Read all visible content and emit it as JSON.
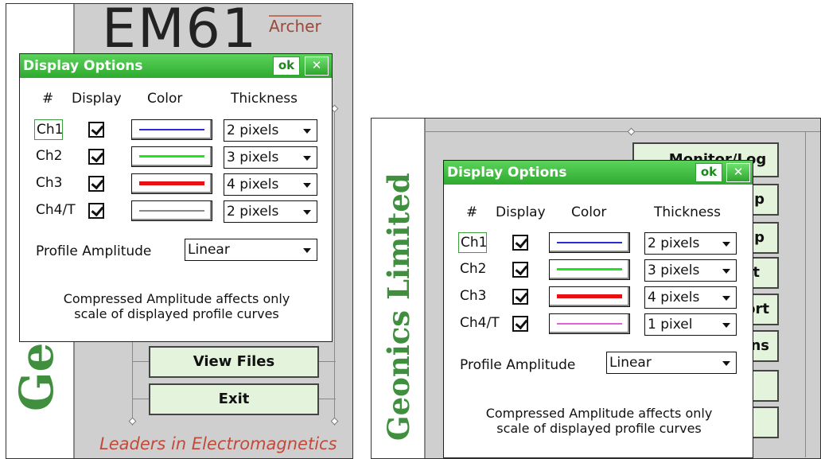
{
  "panel_left": {
    "app_title": "EM61",
    "variant": "Archer",
    "brand_vertical": "Ge",
    "tagline": "Leaders in Electromagnetics",
    "menu": [
      {
        "label": "View Files",
        "mnemonic": "V"
      },
      {
        "label": "Exit",
        "mnemonic": "x"
      }
    ],
    "dialog": {
      "title": "Display Options",
      "ok_label": "ok",
      "close_label": "✕",
      "headers": {
        "num": "#",
        "display": "Display",
        "color": "Color",
        "thickness": "Thickness"
      },
      "channels": [
        {
          "label": "Ch1",
          "checked": true,
          "color": "#2a2ad6",
          "thickness": "2 pixels"
        },
        {
          "label": "Ch2",
          "checked": true,
          "color": "#1fe61f",
          "thickness": "3 pixels"
        },
        {
          "label": "Ch3",
          "checked": true,
          "color": "#e81010",
          "thickness": "4 pixels"
        },
        {
          "label": "Ch4/T",
          "checked": true,
          "color": "#8a8a8a",
          "thickness": "2 pixels"
        }
      ],
      "profile_label": "Profile Amplitude",
      "profile_value": "Linear",
      "note_line1": "Compressed Amplitude affects only",
      "note_line2": "scale of displayed profile curves"
    }
  },
  "panel_right": {
    "brand_vertical": "Geonics Limited",
    "menu_partial": [
      "Monitor/Log",
      "up",
      "up",
      "rt",
      "ort",
      "ons"
    ],
    "dialog": {
      "title": "Display Options",
      "ok_label": "ok",
      "close_label": "✕",
      "headers": {
        "num": "#",
        "display": "Display",
        "color": "Color",
        "thickness": "Thickness"
      },
      "channels": [
        {
          "label": "Ch1",
          "checked": true,
          "color": "#2a2ad6",
          "thickness": "2 pixels"
        },
        {
          "label": "Ch2",
          "checked": true,
          "color": "#1fe61f",
          "thickness": "3 pixels"
        },
        {
          "label": "Ch3",
          "checked": true,
          "color": "#e81010",
          "thickness": "4 pixels"
        },
        {
          "label": "Ch4/T",
          "checked": true,
          "color": "#e060e0",
          "thickness": "1 pixel"
        }
      ],
      "profile_label": "Profile Amplitude",
      "profile_value": "Linear",
      "note_line1": "Compressed Amplitude affects only",
      "note_line2": "scale of displayed profile curves"
    }
  },
  "colors": {
    "title_green": "#2eaa2e",
    "button_bg": "#e4f4dc",
    "brand_green": "#3f8f3f",
    "tagline_red": "#c24a3a"
  }
}
